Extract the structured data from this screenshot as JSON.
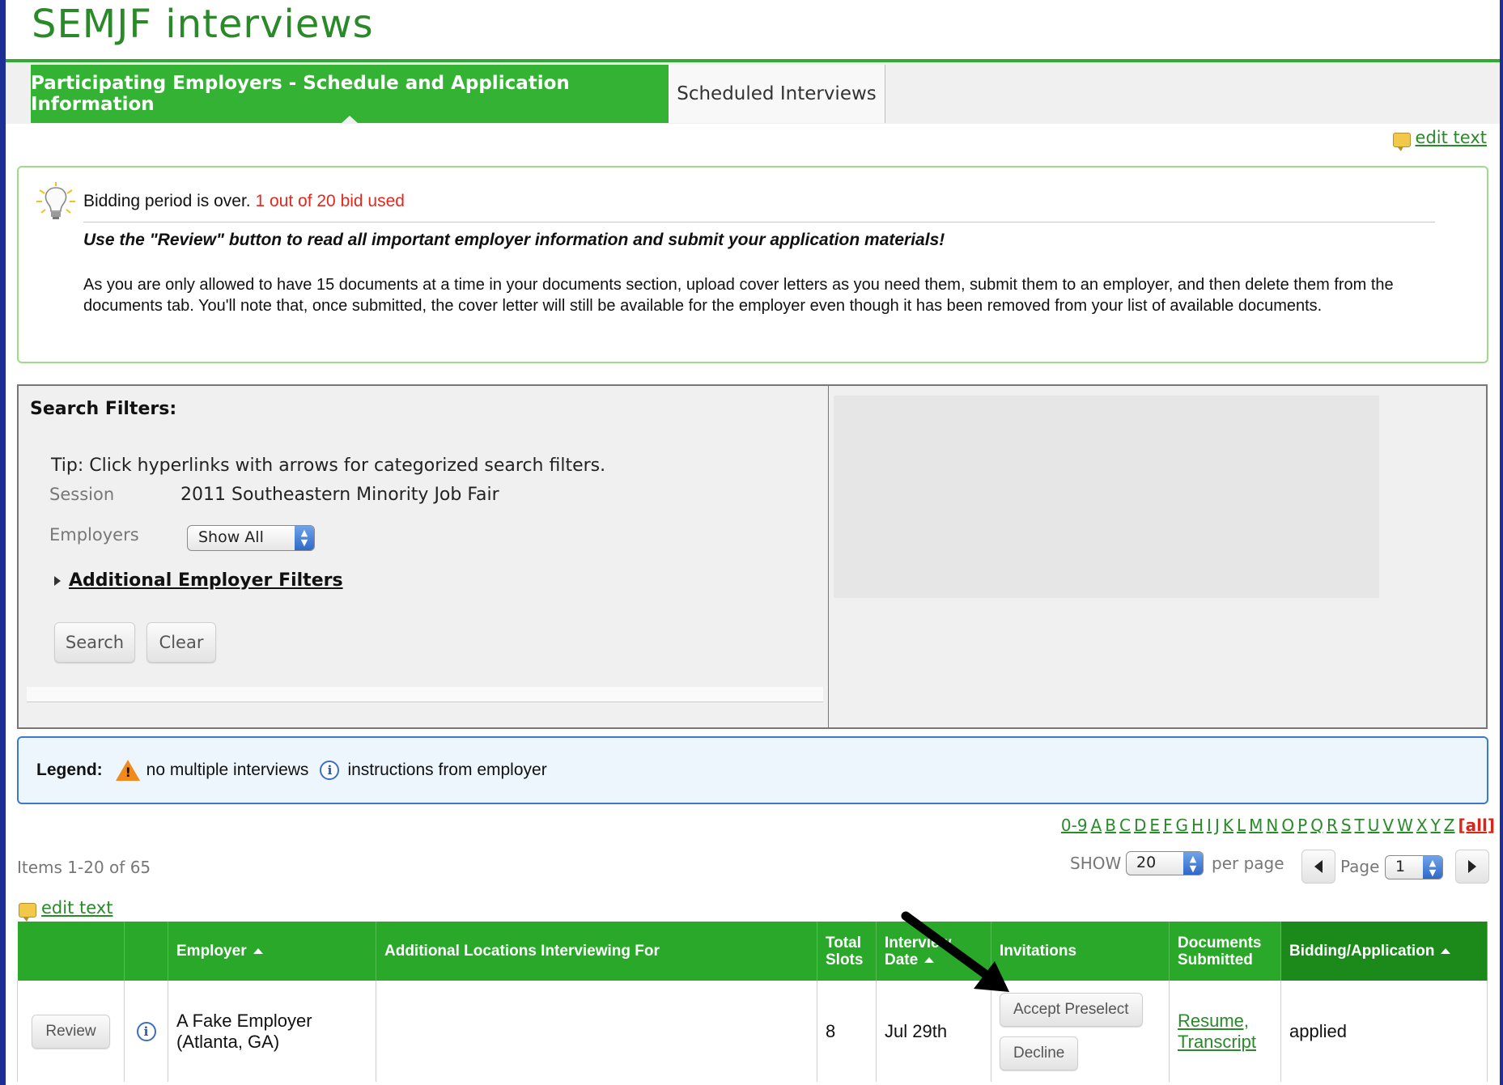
{
  "header": {
    "title": "SEMJF interviews"
  },
  "tabs": [
    {
      "label": "Participating Employers - Schedule and Application Information",
      "active": true
    },
    {
      "label": "Scheduled Interviews",
      "active": false
    }
  ],
  "edit_text_label": "edit text",
  "info": {
    "bidding_status": "Bidding period is over.",
    "bid_used": "1 out of 20 bid used",
    "review_instruction": "Use the \"Review\" button to read all important employer information and submit your application materials!",
    "documents_note": "As you are only allowed to have 15 documents at a time in your documents section, upload cover letters as you need them, submit them to an employer, and then delete them from the documents tab. You'll note that, once submitted, the cover letter will still be available for the employer even though it has been removed from your list of available documents."
  },
  "filters": {
    "heading": "Search Filters:",
    "tip": "Tip: Click hyperlinks with arrows for categorized search filters.",
    "session_label": "Session",
    "session_value": "2011 Southeastern Minority Job Fair",
    "employers_label": "Employers",
    "employers_selected": "Show All",
    "additional_filters": "Additional Employer Filters",
    "search_button": "Search",
    "clear_button": "Clear"
  },
  "legend": {
    "label": "Legend:",
    "warning_text": "no multiple interviews",
    "info_text": "instructions from employer"
  },
  "alpha_index": [
    "0-9",
    "A",
    "B",
    "C",
    "D",
    "E",
    "F",
    "G",
    "H",
    "I",
    "J",
    "K",
    "L",
    "M",
    "N",
    "O",
    "P",
    "Q",
    "R",
    "S",
    "T",
    "U",
    "V",
    "W",
    "X",
    "Y",
    "Z",
    "[all]"
  ],
  "pagination": {
    "items_count": "Items 1-20 of 65",
    "show_label": "SHOW",
    "per_page_value": "20",
    "per_page_label": "per page",
    "page_label": "Page",
    "page_value": "1"
  },
  "table": {
    "headers": {
      "employer": "Employer",
      "locations": "Additional Locations Interviewing For",
      "total_slots": "Total Slots",
      "interview_date": "Interview Date",
      "invitations": "Invitations",
      "documents": "Documents Submitted",
      "bidding": "Bidding/Application"
    },
    "rows": [
      {
        "review_button": "Review",
        "employer": "A Fake Employer (Atlanta, GA)",
        "locations": "",
        "total_slots": "8",
        "interview_date": "Jul 29th",
        "accept_button": "Accept Preselect",
        "decline_button": "Decline",
        "doc_resume": "Resume,",
        "doc_transcript": "Transcript",
        "status": "applied"
      }
    ]
  },
  "icons": {
    "bulb": "lightbulb-icon",
    "note": "note-icon",
    "warning": "warning-icon",
    "info": "info-icon",
    "annotation": "arrow-annotation"
  },
  "colors": {
    "brand_green": "#34b234",
    "title_green": "#2a8a2a",
    "bid_red": "#e0291f",
    "legend_blue": "#3b7bc9",
    "outer_frame": "#1d2f96"
  }
}
